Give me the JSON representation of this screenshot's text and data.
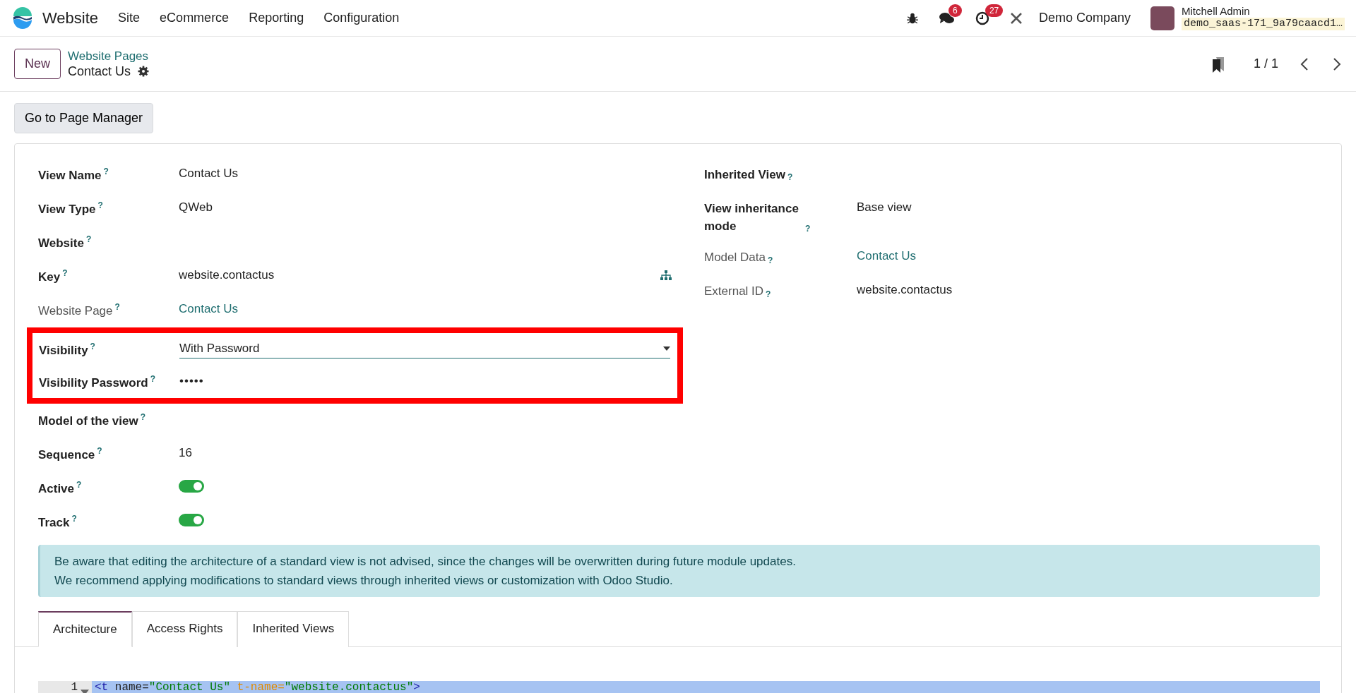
{
  "navbar": {
    "app_name": "Website",
    "menu": [
      "Site",
      "eCommerce",
      "Reporting",
      "Configuration"
    ],
    "messages_count": "6",
    "activities_count": "27",
    "company": "Demo Company",
    "user_name": "Mitchell Admin",
    "database": "demo_saas-171_9a79caacd1…"
  },
  "control_panel": {
    "new_button": "New",
    "breadcrumb_parent": "Website Pages",
    "breadcrumb_current": "Contact Us",
    "pager": "1 / 1"
  },
  "page_manager_button": "Go to Page Manager",
  "left_fields": [
    {
      "label": "View Name",
      "help": "?",
      "kind": "text",
      "value": "Contact Us",
      "muted": false,
      "highlighted": false
    },
    {
      "label": "View Type",
      "help": "?",
      "kind": "text",
      "value": "QWeb",
      "muted": false,
      "highlighted": false
    },
    {
      "label": "Website",
      "help": "?",
      "kind": "empty",
      "muted": false,
      "highlighted": false
    },
    {
      "label": "Key",
      "help": "?",
      "kind": "key",
      "value": "website.contactus",
      "muted": false,
      "highlighted": false
    },
    {
      "label": "Website Page",
      "help": "?",
      "kind": "link",
      "value": "Contact Us",
      "muted": true,
      "highlighted": false
    },
    {
      "label": "Visibility",
      "help": "?",
      "kind": "select",
      "value": "With Password",
      "muted": false,
      "highlighted": true
    },
    {
      "label": "Visibility Password",
      "help": "?",
      "kind": "password",
      "value": "•••••",
      "muted": false,
      "highlighted": true
    },
    {
      "label": "Model of the view",
      "help": "?",
      "kind": "empty",
      "muted": false,
      "highlighted": false
    },
    {
      "label": "Sequence",
      "help": "?",
      "kind": "text",
      "value": "16",
      "muted": false,
      "highlighted": false
    },
    {
      "label": "Active",
      "help": "?",
      "kind": "toggle",
      "on": true,
      "muted": false,
      "highlighted": false
    },
    {
      "label": "Track",
      "help": "?",
      "kind": "toggle",
      "on": true,
      "muted": false,
      "highlighted": false
    }
  ],
  "right_fields": [
    {
      "label": "Inherited View",
      "help": "?",
      "kind": "empty",
      "muted": false
    },
    {
      "label": "View inheritance mode",
      "help": "?",
      "kind": "text",
      "value": "Base view",
      "muted": false
    },
    {
      "label": "Model Data",
      "help": "?",
      "kind": "link",
      "value": "Contact Us",
      "muted": true
    },
    {
      "label": "External ID",
      "help": "?",
      "kind": "text",
      "value": "website.contactus",
      "muted": true
    }
  ],
  "alert": [
    "Be aware that editing the architecture of a standard view is not advised, since the changes will be overwritten during future module updates.",
    "We recommend applying modifications to standard views through inherited views or customization with Odoo Studio."
  ],
  "tabs": [
    {
      "label": "Architecture",
      "selected": true
    },
    {
      "label": "Access Rights",
      "selected": false
    },
    {
      "label": "Inherited Views",
      "selected": false
    }
  ],
  "code": {
    "line_number": "1",
    "tokens": [
      {
        "kind": "tag",
        "text": "<t"
      },
      {
        "kind": "attr",
        "text": " name="
      },
      {
        "kind": "string",
        "text": "\"Contact Us\""
      },
      {
        "kind": "attr2",
        "text": " t-name="
      },
      {
        "kind": "string",
        "text": "\"website.contactus\""
      },
      {
        "kind": "tag",
        "text": ">"
      }
    ]
  }
}
